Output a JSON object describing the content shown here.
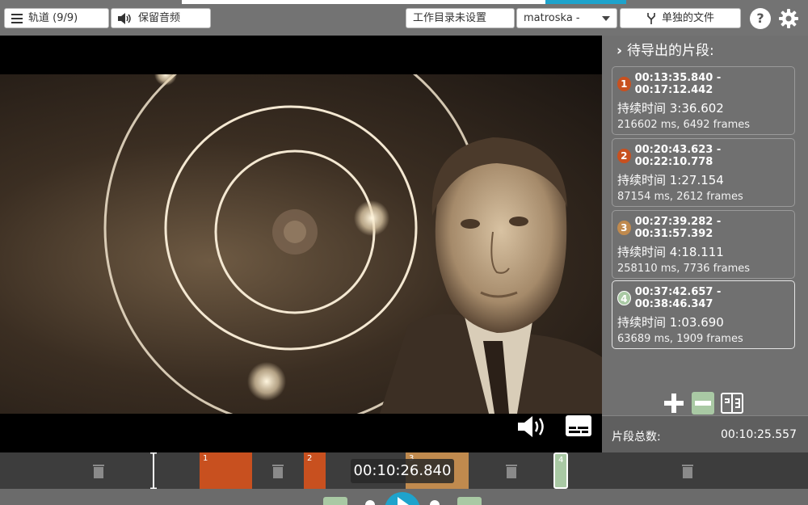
{
  "toolbar": {
    "tracks_label": "轨道 (9/9)",
    "keep_audio_label": "保留音频",
    "workdir_label": "工作目录未设置",
    "format_value": "matroska -",
    "output_mode_label": "单独的文件",
    "help_label": "?"
  },
  "panel": {
    "title": "待导出的片段:",
    "segments": [
      {
        "num": "1",
        "range": "00:13:35.840 - 00:17:12.442",
        "duration": "持续时间 3:36.602",
        "details": "216602 ms, 6492 frames",
        "color": "#c8501f"
      },
      {
        "num": "2",
        "range": "00:20:43.623 - 00:22:10.778",
        "duration": "持续时间 1:27.154",
        "details": "87154 ms, 2612 frames",
        "color": "#c8501f"
      },
      {
        "num": "3",
        "range": "00:27:39.282 - 00:31:57.392",
        "duration": "持续时间 4:18.111",
        "details": "258110 ms, 7736 frames",
        "color": "#c08a4e"
      },
      {
        "num": "4",
        "range": "00:37:42.657 - 00:38:46.347",
        "duration": "持续时间 1:03.690",
        "details": "63689 ms, 1909 frames",
        "color": "#a9c9a4"
      }
    ],
    "total_label": "片段总数:",
    "total_value": "00:10:25.557"
  },
  "timeline": {
    "current_time": "00:10:26.840",
    "segments": [
      {
        "num": "1",
        "color": "#c8501f"
      },
      {
        "num": "2",
        "color": "#c8501f"
      },
      {
        "num": "3",
        "color": "#c08a4e"
      },
      {
        "num": "4",
        "color": "#a9c9a4"
      }
    ]
  }
}
